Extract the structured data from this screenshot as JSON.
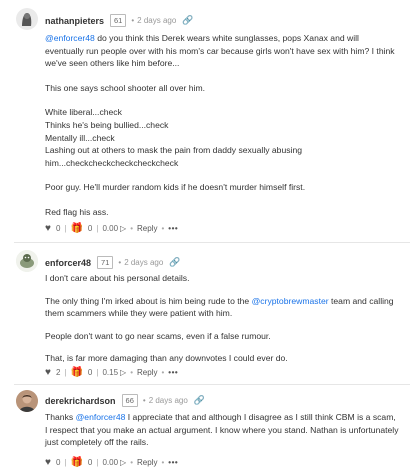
{
  "comments": [
    {
      "username": "nathanpieters",
      "reputation": "61",
      "bullet": "•",
      "time": "2 days ago",
      "paragraphs": [
        {
          "mention": "@enforcer48",
          "text": " do you think this Derek wears white sunglasses, pops Xanax and will eventually run people over with his mom's car because girls won't have sex with him? I think we've seen others like him before..."
        },
        {
          "text": "This one says school shooter all over him."
        },
        {
          "lines": [
            "White liberal...check",
            "Thinks he's being bullied...check",
            "Mentally ill...check",
            "Lashing out at others to mask the pain from daddy sexually abusing him...checkcheckcheckcheckcheck"
          ]
        },
        {
          "text": "Poor guy. He'll murder random kids if he doesn't murder himself first."
        },
        {
          "text": "Red flag his ass."
        }
      ],
      "votes": "0",
      "coins": "0",
      "payout": "0.00",
      "reply_label": "Reply",
      "more_label": "•••"
    },
    {
      "username": "enforcer48",
      "reputation": "71",
      "bullet": "•",
      "time": "2 days ago",
      "paragraphs": [
        {
          "text": "I don't care about his personal details."
        },
        {
          "pre": "The only thing I'm irked about is him being rude to the ",
          "mention": "@cryptobrewmaster",
          "text": " team and calling them scammers while they were patient with him."
        },
        {
          "text": "People don't want to go near scams, even if a false rumour."
        },
        {
          "text": "That, is far more damaging than any downvotes I could ever do."
        }
      ],
      "votes": "2",
      "coins": "0",
      "payout": "0.15",
      "reply_label": "Reply",
      "more_label": "•••"
    },
    {
      "username": "derekrichardson",
      "reputation": "66",
      "bullet": "•",
      "time": "2 days ago",
      "paragraphs": [
        {
          "pre": "Thanks ",
          "mention": "@enforcer48",
          "text": " I appreciate that and although I disagree as I still think CBM is a scam, I respect that you make an actual argument. I know where you stand. Nathan is unfortunately just completely off the rails."
        }
      ],
      "votes": "0",
      "coins": "0",
      "payout": "0.00",
      "reply_label": "Reply",
      "more_label": "•••"
    }
  ],
  "icons": {
    "upvote": "heart-icon",
    "gift": "gift-icon",
    "payout": "payout-icon",
    "link": "link-icon",
    "more": "more-icon"
  }
}
